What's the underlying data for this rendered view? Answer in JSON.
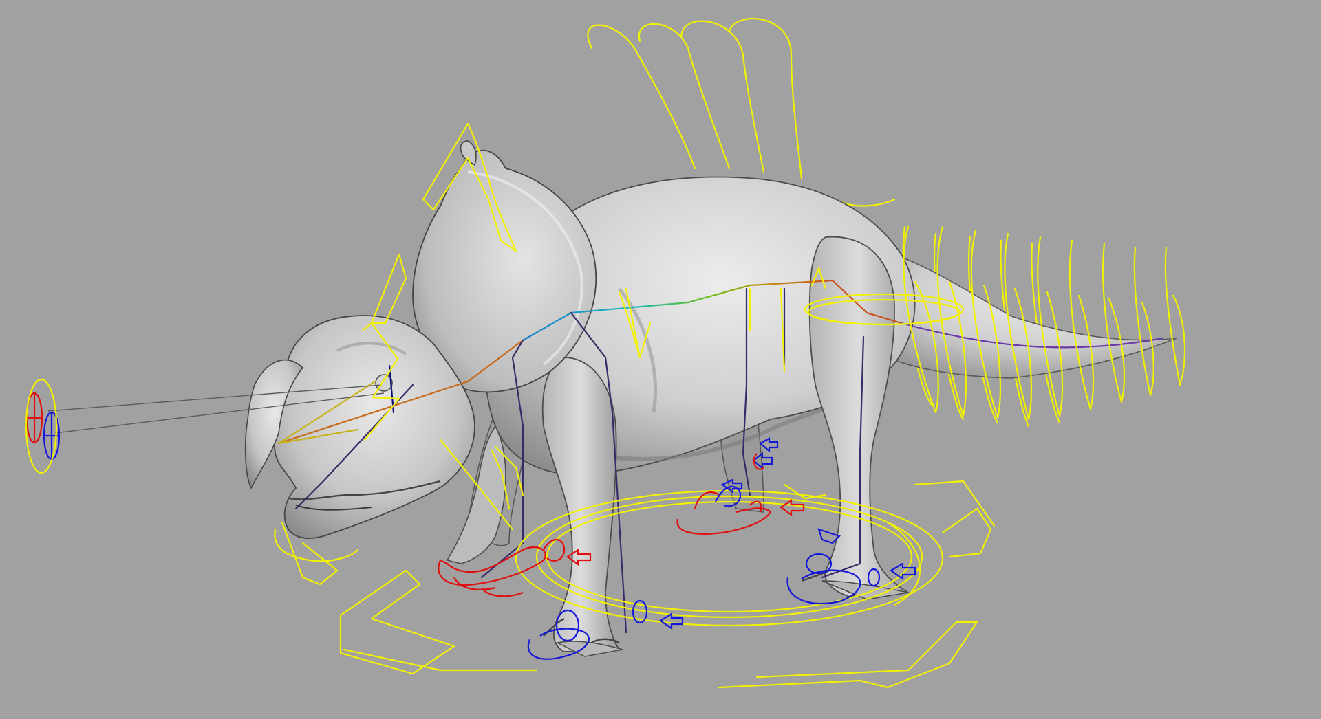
{
  "viewport": {
    "label": "",
    "background": "#a1a1a1",
    "shading": "smooth-shaded",
    "subject": "ceratopsian-dinosaur-rig"
  },
  "colors": {
    "mesh": "#cdcdcd",
    "controls_yellow": "#f2f200",
    "controls_red": "#e01010",
    "controls_blue": "#1418d8"
  },
  "icons": [
    "look-at-target-icon",
    "fk-arrow-icon",
    "ik-foot-control-icon"
  ]
}
